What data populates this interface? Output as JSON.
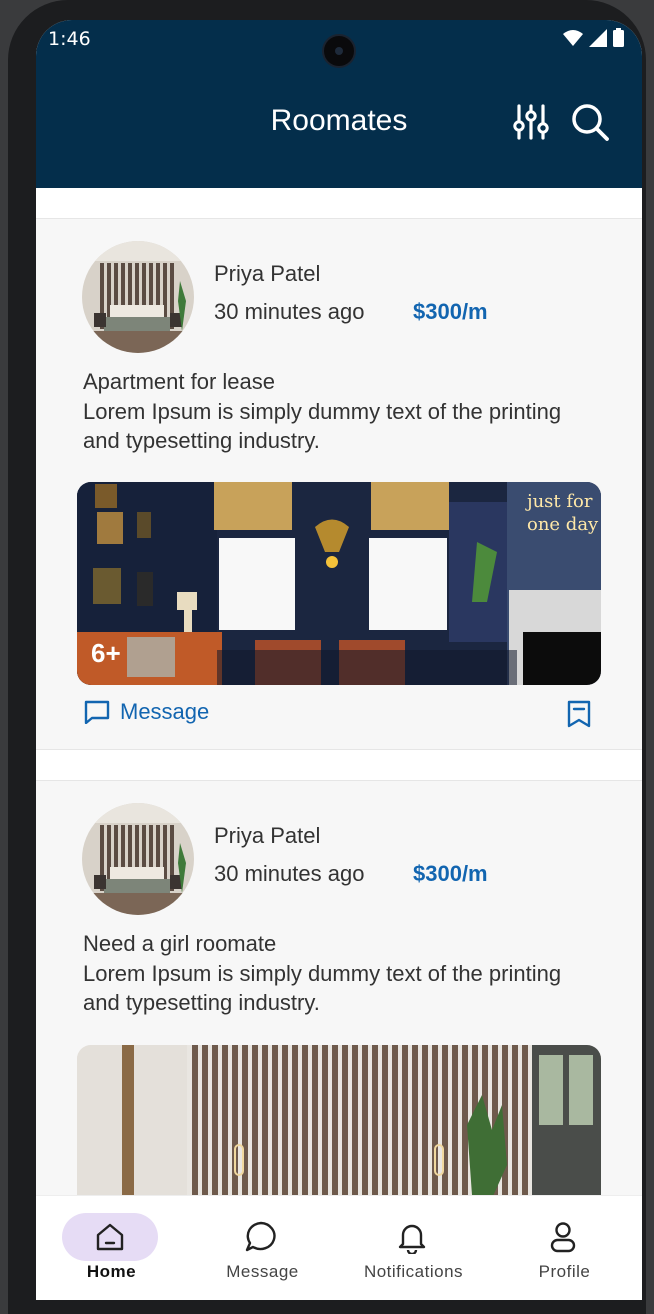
{
  "status_bar": {
    "time": "1:46"
  },
  "app_bar": {
    "title": "Roomates",
    "filter_icon": "sliders-icon",
    "search_icon": "search-icon"
  },
  "posts": [
    {
      "author": "Priya Patel",
      "time_ago": "30 minutes ago",
      "price": "$300/m",
      "title": "Apartment for lease",
      "description": "Lorem Ipsum is simply dummy text of the printing and typesetting industry.",
      "photo_badge": "6+",
      "message_label": "Message"
    },
    {
      "author": "Priya Patel",
      "time_ago": "30 minutes ago",
      "price": "$300/m",
      "title": "Need a girl roomate",
      "description": "Lorem Ipsum is simply dummy text of the printing and typesetting industry."
    }
  ],
  "bottom_nav": {
    "items": [
      {
        "label": "Home",
        "icon": "home-icon",
        "active": true
      },
      {
        "label": "Message",
        "icon": "chat-bubble-icon",
        "active": false
      },
      {
        "label": "Notifications",
        "icon": "bell-icon",
        "active": false
      },
      {
        "label": "Profile",
        "icon": "person-icon",
        "active": false
      }
    ]
  },
  "colors": {
    "app_bar": "#042e4b",
    "accent": "#1265b0",
    "nav_active": "#e6dcf5"
  }
}
